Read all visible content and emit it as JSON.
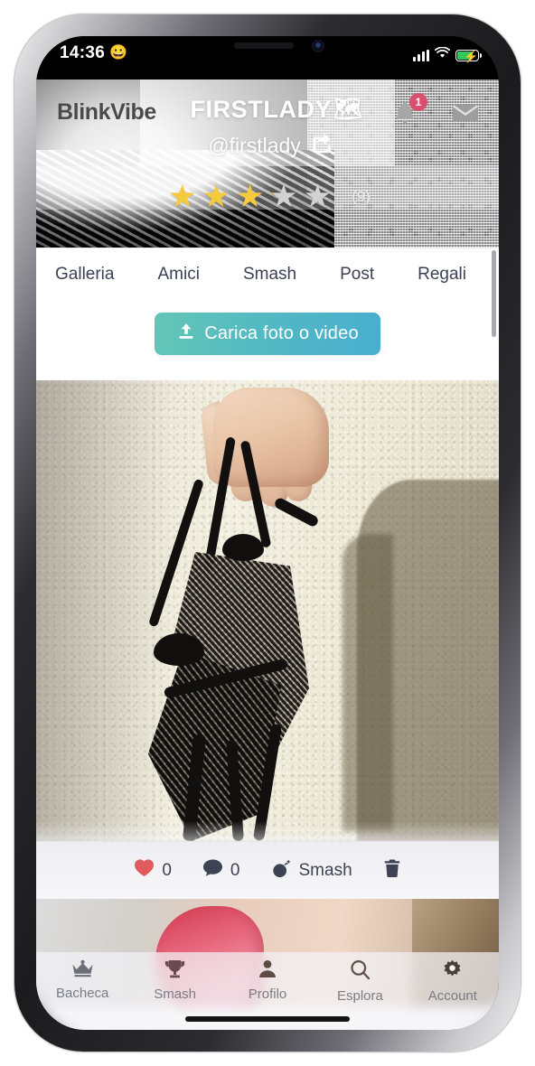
{
  "status_bar": {
    "time": "14:36",
    "emoji": "😀",
    "signal_icon": "signal-bars-icon",
    "wifi_icon": "wifi-icon",
    "battery_icon": "battery-charging-icon"
  },
  "header": {
    "brand": "BlinkVibe",
    "profile_name": "FIRSTLADY",
    "profile_name_emoji": "🗺",
    "handle": "@firstlady",
    "share_icon": "share-icon",
    "bell_icon": "bell-icon",
    "notification_badge": "1",
    "mail_icon": "envelope-icon",
    "rating": {
      "value": 3.15,
      "max": 5,
      "count_label": "(9)",
      "star_color": "#f5cb3d",
      "empty_star_color": "#d2d2d2"
    }
  },
  "tabs": [
    {
      "label": "Galleria"
    },
    {
      "label": "Amici"
    },
    {
      "label": "Smash"
    },
    {
      "label": "Post"
    },
    {
      "label": "Regali"
    }
  ],
  "upload": {
    "label": "Carica foto o video",
    "icon": "upload-icon",
    "gradient_from": "#63c6b6",
    "gradient_to": "#49aecf"
  },
  "post": {
    "photo_alt": "hand holding black lace lingerie against a cream wall",
    "actions": {
      "like_icon": "heart-icon",
      "like_count": "0",
      "like_color": "#e05c5c",
      "comment_icon": "comment-icon",
      "comment_count": "0",
      "smash_icon": "bomb-icon",
      "smash_label": "Smash",
      "delete_icon": "trash-icon"
    }
  },
  "bottom_nav": [
    {
      "label": "Bacheca",
      "icon": "crown-icon"
    },
    {
      "label": "Smash",
      "icon": "trophy-icon"
    },
    {
      "label": "Profilo",
      "icon": "person-icon"
    },
    {
      "label": "Esplora",
      "icon": "search-icon"
    },
    {
      "label": "Account",
      "icon": "gear-icon"
    }
  ]
}
